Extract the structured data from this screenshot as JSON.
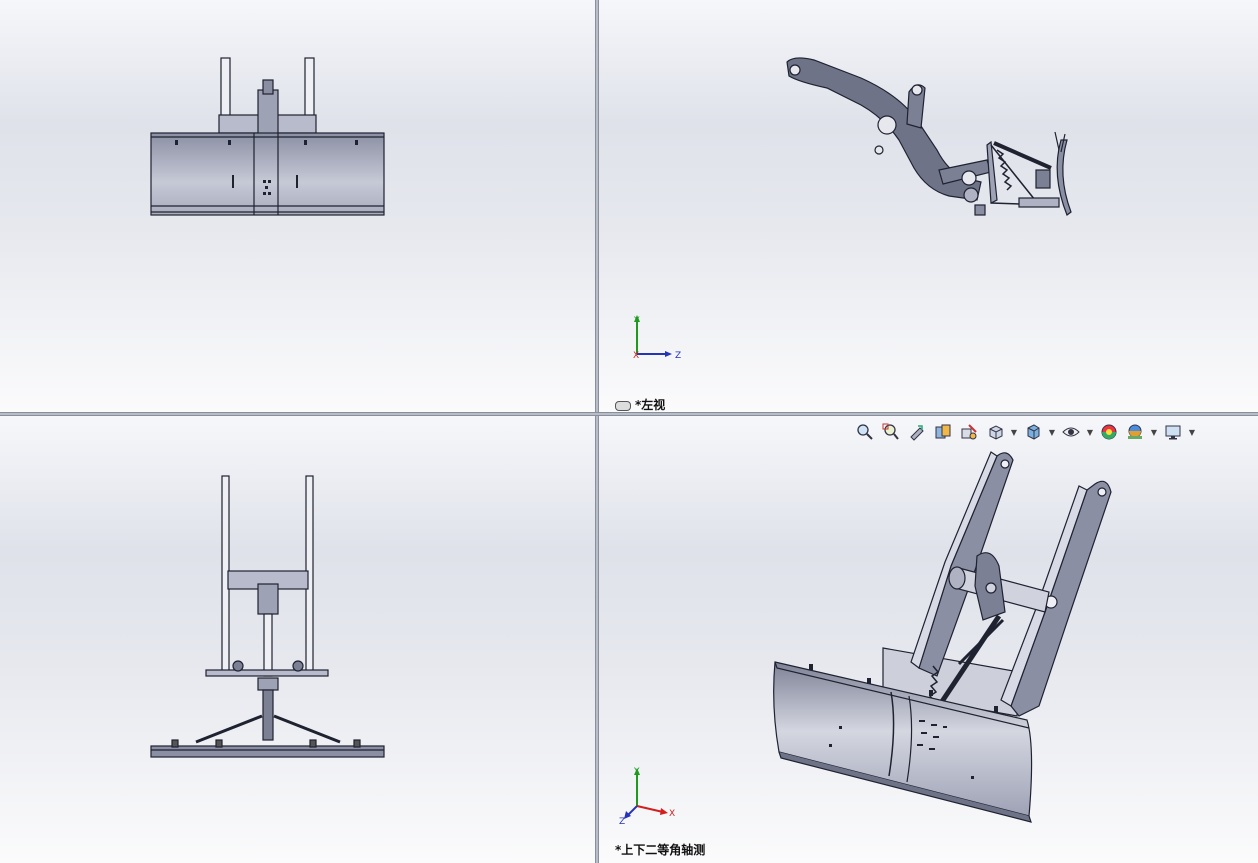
{
  "viewports": {
    "left": {
      "label": "*左视"
    },
    "iso": {
      "label": "*上下二等角轴测"
    }
  },
  "triad": {
    "x": "X",
    "y": "Y",
    "z": "Z"
  },
  "toolbar": [
    {
      "name": "zoom-to-fit-icon"
    },
    {
      "name": "zoom-to-area-icon"
    },
    {
      "name": "previous-view-icon"
    },
    {
      "name": "section-view-icon"
    },
    {
      "name": "dynamic-annotation-icon"
    },
    {
      "name": "view-orientation-icon",
      "caret": true
    },
    {
      "name": "display-style-icon",
      "caret": true
    },
    {
      "name": "hide-show-items-icon",
      "caret": true
    },
    {
      "name": "edit-appearance-icon"
    },
    {
      "name": "apply-scene-icon",
      "caret": true
    },
    {
      "name": "view-settings-icon",
      "caret": true
    }
  ],
  "colors": {
    "part_fill": "#6f7388",
    "part_light": "#aeb2c3",
    "outline": "#1f2230",
    "axis_x": "#d02020",
    "axis_y": "#1f9a1f",
    "axis_z": "#2433b8"
  }
}
